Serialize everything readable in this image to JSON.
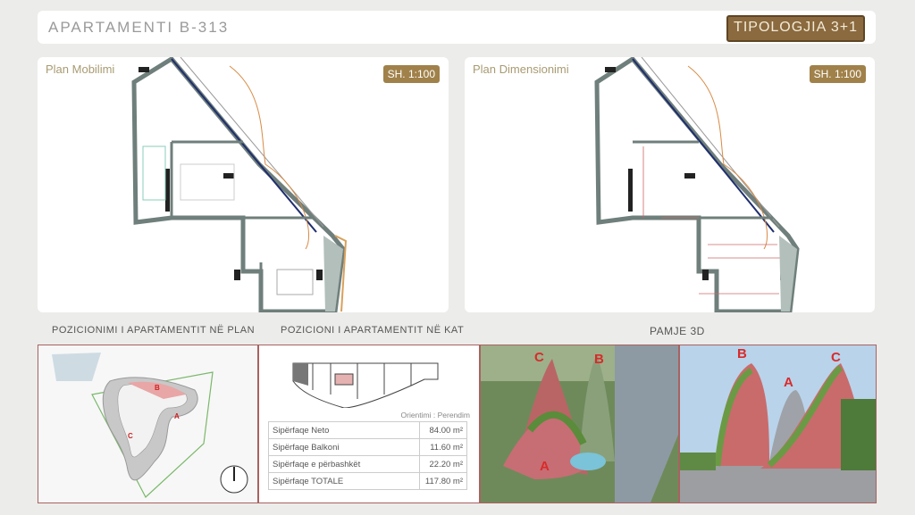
{
  "header": {
    "title": "APARTAMENTI B-313",
    "typology": "TIPOLOGJIA 3+1"
  },
  "plan_left": {
    "title": "Plan Mobilimi",
    "scale": "SH. 1:100"
  },
  "plan_right": {
    "title": "Plan Dimensionimi",
    "scale": "SH. 1:100"
  },
  "sections": {
    "position_plan": "POZICIONIMI I APARTAMENTIT NË PLAN",
    "position_floor": "POZICIONI I APARTAMENTIT NË KAT",
    "view3d": "PAMJE 3D"
  },
  "site_labels": {
    "a": "A",
    "b": "B",
    "c": "C"
  },
  "orientation": {
    "label": "Orientimi",
    "value": "Perendim"
  },
  "areas": [
    {
      "label": "Sipërfaqe Neto",
      "value": "84.00",
      "unit": "m²"
    },
    {
      "label": "Sipërfaqe Balkoni",
      "value": "11.60",
      "unit": "m²"
    },
    {
      "label": "Sipërfaqe e përbashkët",
      "value": "22.20",
      "unit": "m²"
    },
    {
      "label": "Sipërfaqe TOTALE",
      "value": "117.80",
      "unit": "m²"
    }
  ],
  "render_labels": {
    "a": "A",
    "b": "B",
    "c": "C"
  }
}
